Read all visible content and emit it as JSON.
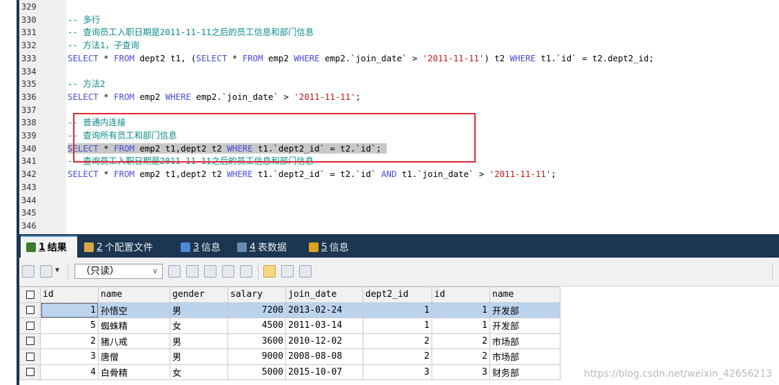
{
  "editor": {
    "lines": [
      {
        "n": "329",
        "tokens": []
      },
      {
        "n": "330",
        "tokens": [
          {
            "t": "-- 多行",
            "c": "cm"
          }
        ]
      },
      {
        "n": "331",
        "tokens": [
          {
            "t": "-- 查询员工入职日期是2011-11-11之后的员工信息和部门信息",
            "c": "cm"
          }
        ]
      },
      {
        "n": "332",
        "tokens": [
          {
            "t": "-- 方法1，子查询",
            "c": "cm"
          }
        ]
      },
      {
        "n": "333",
        "tokens": [
          {
            "t": "SELECT",
            "c": "kw"
          },
          {
            "t": " * ",
            "c": "op"
          },
          {
            "t": "FROM",
            "c": "kw"
          },
          {
            "t": " dept2 t1, (",
            "c": "id"
          },
          {
            "t": "SELECT",
            "c": "kw"
          },
          {
            "t": " * ",
            "c": "op"
          },
          {
            "t": "FROM",
            "c": "kw"
          },
          {
            "t": " emp2 ",
            "c": "id"
          },
          {
            "t": "WHERE",
            "c": "kw"
          },
          {
            "t": " emp2.`join_date` > ",
            "c": "id"
          },
          {
            "t": "'2011-11-11'",
            "c": "str"
          },
          {
            "t": ") t2 ",
            "c": "id"
          },
          {
            "t": "WHERE",
            "c": "kw"
          },
          {
            "t": " t1.`id` = t2.dept2_id;",
            "c": "id"
          }
        ]
      },
      {
        "n": "334",
        "tokens": []
      },
      {
        "n": "335",
        "tokens": [
          {
            "t": "-- 方法2",
            "c": "cm"
          }
        ]
      },
      {
        "n": "336",
        "tokens": [
          {
            "t": "SELECT",
            "c": "kw"
          },
          {
            "t": " * ",
            "c": "op"
          },
          {
            "t": "FROM",
            "c": "kw"
          },
          {
            "t": " emp2 ",
            "c": "id"
          },
          {
            "t": "WHERE",
            "c": "kw"
          },
          {
            "t": " emp2.`join_date` > ",
            "c": "id"
          },
          {
            "t": "'2011-11-11'",
            "c": "str"
          },
          {
            "t": ";",
            "c": "id"
          }
        ]
      },
      {
        "n": "337",
        "tokens": []
      },
      {
        "n": "338",
        "tokens": [
          {
            "t": "-- 普通内连接",
            "c": "cm"
          }
        ]
      },
      {
        "n": "339",
        "tokens": [
          {
            "t": "-- 查询所有员工和部门信息",
            "c": "cm"
          }
        ]
      },
      {
        "n": "340",
        "hl": true,
        "tokens": [
          {
            "t": "SELECT",
            "c": "kw"
          },
          {
            "t": " * ",
            "c": "op"
          },
          {
            "t": "FROM",
            "c": "kw"
          },
          {
            "t": " emp2 t1,dept2 t2 ",
            "c": "id"
          },
          {
            "t": "WHERE",
            "c": "kw"
          },
          {
            "t": " t1.`dept2_id` = t2.`id`; ",
            "c": "id"
          }
        ]
      },
      {
        "n": "341",
        "tokens": [
          {
            "t": "-- 查询员工入职日期是2011-11-11之后的员工信息和部门信息",
            "c": "cm"
          }
        ]
      },
      {
        "n": "342",
        "tokens": [
          {
            "t": "SELECT",
            "c": "kw"
          },
          {
            "t": " * ",
            "c": "op"
          },
          {
            "t": "FROM",
            "c": "kw"
          },
          {
            "t": " emp2 t1,dept2 t2 ",
            "c": "id"
          },
          {
            "t": "WHERE",
            "c": "kw"
          },
          {
            "t": " t1.`dept2_id` = t2.`id` ",
            "c": "id"
          },
          {
            "t": "AND",
            "c": "kw"
          },
          {
            "t": " t1.`join_date` > ",
            "c": "id"
          },
          {
            "t": "'2011-11-11'",
            "c": "str"
          },
          {
            "t": ";",
            "c": "id"
          }
        ]
      },
      {
        "n": "343",
        "tokens": []
      },
      {
        "n": "344",
        "tokens": []
      },
      {
        "n": "345",
        "tokens": []
      },
      {
        "n": "346",
        "tokens": []
      }
    ]
  },
  "tabs": [
    {
      "num": "1",
      "label": "结果",
      "icon": "result-grid-icon",
      "color": "#3a7d2c",
      "active": true
    },
    {
      "num": "2",
      "label": "个配置文件",
      "icon": "profile-icon",
      "color": "#d8a84a",
      "active": false
    },
    {
      "num": "3",
      "label": "信息",
      "icon": "info-icon",
      "color": "#4a8ad8",
      "active": false
    },
    {
      "num": "4",
      "label": "表数据",
      "icon": "table-data-icon",
      "color": "#6c8bb0",
      "active": false
    },
    {
      "num": "5",
      "label": "信息",
      "icon": "info-chart-icon",
      "color": "#e0a020",
      "active": false
    }
  ],
  "toolbar": {
    "mode_select": "（只读）",
    "icons": [
      "export-grid-icon",
      "import-dropdown-icon",
      "add-row-icon",
      "copy-row-icon",
      "save-icon",
      "delete-icon",
      "revert-icon",
      "grid-view-icon",
      "form-view-icon",
      "text-view-icon"
    ]
  },
  "grid": {
    "columns": [
      "id",
      "name",
      "gender",
      "salary",
      "join_date",
      "dept2_id",
      "id",
      "name"
    ],
    "rows": [
      [
        "1",
        "孙悟空",
        "男",
        "7200",
        "2013-02-24",
        "1",
        "1",
        "开发部"
      ],
      [
        "5",
        "蜘蛛精",
        "女",
        "4500",
        "2011-03-14",
        "1",
        "1",
        "开发部"
      ],
      [
        "2",
        "猪八戒",
        "男",
        "3600",
        "2010-12-02",
        "2",
        "2",
        "市场部"
      ],
      [
        "3",
        "唐僧",
        "男",
        "9000",
        "2008-08-08",
        "2",
        "2",
        "市场部"
      ],
      [
        "4",
        "白骨精",
        "女",
        "5000",
        "2015-10-07",
        "3",
        "3",
        "财务部"
      ]
    ]
  },
  "watermark": "https://blog.csdn.net/weixin_42656213",
  "colors": {
    "keyword": "#4b4bd8",
    "string": "#c01818",
    "comment": "#0a8a8a",
    "highlight_box": "#e0262d",
    "tab_bar": "#1c3550"
  }
}
